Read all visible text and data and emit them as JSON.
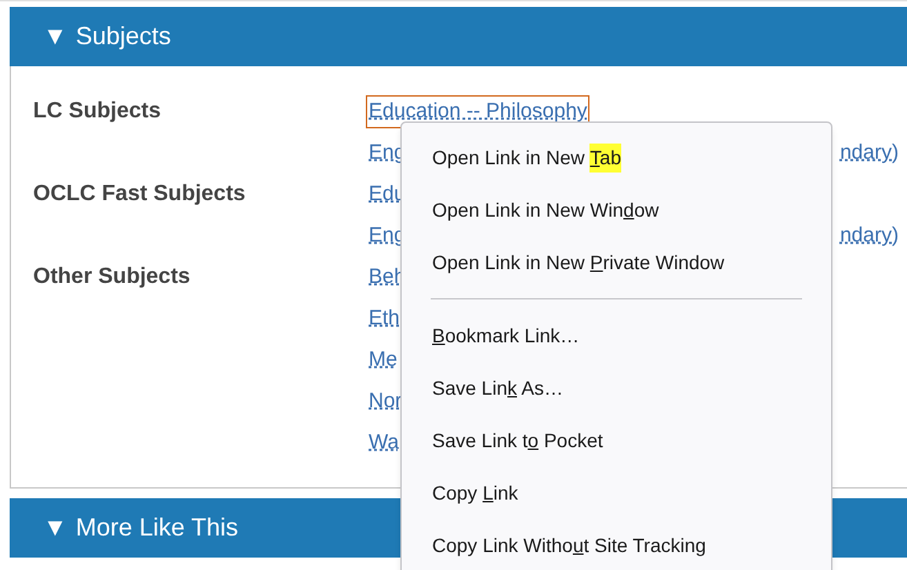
{
  "sections": [
    {
      "toggle": "▼",
      "title": "Subjects"
    },
    {
      "toggle": "▼",
      "title": "More Like This"
    }
  ],
  "subject_groups": [
    {
      "label": "LC Subjects",
      "links": [
        {
          "text": "Education -- Philosophy",
          "focused": true
        },
        {
          "text": "Eng",
          "tail": "ndary)",
          "focused": false
        }
      ]
    },
    {
      "label": "OCLC Fast Subjects",
      "links": [
        {
          "text": "Edu",
          "focused": false
        },
        {
          "text": "Eng",
          "tail": "ndary)",
          "focused": false
        }
      ]
    },
    {
      "label": "Other Subjects",
      "links": [
        {
          "text": "Beh",
          "focused": false
        },
        {
          "text": "Eth",
          "focused": false
        },
        {
          "text": "Me",
          "focused": false
        },
        {
          "text": "Nor",
          "focused": false
        },
        {
          "text": "Wa",
          "focused": false
        }
      ]
    }
  ],
  "context_menu": [
    {
      "kind": "item",
      "before": "Open Link in New ",
      "key": "T",
      "after": "ab",
      "highlighted": true
    },
    {
      "kind": "item",
      "before": "Open Link in New Win",
      "key": "d",
      "after": "ow",
      "highlighted": false
    },
    {
      "kind": "item",
      "before": "Open Link in New ",
      "key": "P",
      "after": "rivate Window",
      "highlighted": false
    },
    {
      "kind": "separator"
    },
    {
      "kind": "item",
      "key": "B",
      "after": "ookmark Link…",
      "highlighted": false
    },
    {
      "kind": "item",
      "before": "Save Lin",
      "key": "k",
      "after": " As…",
      "highlighted": false
    },
    {
      "kind": "item",
      "before": "Save Link t",
      "key": "o",
      "after": " Pocket",
      "highlighted": false
    },
    {
      "kind": "item",
      "before": "Copy ",
      "key": "L",
      "after": "ink",
      "highlighted": false
    },
    {
      "kind": "item",
      "before": "Copy Link Witho",
      "key": "u",
      "after": "t Site Tracking",
      "highlighted": false
    }
  ]
}
